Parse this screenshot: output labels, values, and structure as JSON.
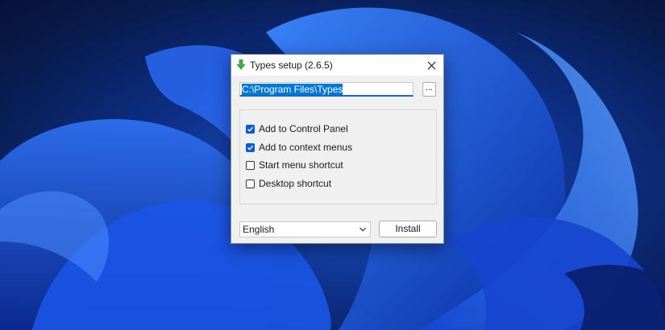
{
  "window": {
    "title": "Types setup (2.6.5)",
    "icon": "green-down-arrow-icon"
  },
  "install_path": {
    "value": "C:\\Program Files\\Types"
  },
  "browse_button": {
    "label": "..."
  },
  "options": [
    {
      "label": "Add to Control Panel",
      "checked": true
    },
    {
      "label": "Add to context menus",
      "checked": true
    },
    {
      "label": "Start menu shortcut",
      "checked": false
    },
    {
      "label": "Desktop shortcut",
      "checked": false
    }
  ],
  "language": {
    "selected": "English"
  },
  "install_button": {
    "label": "Install"
  },
  "colors": {
    "accent": "#0b5ccc",
    "selection": "#0078d7",
    "app_icon": "#3cb043",
    "wallpaper": "#0d2f86"
  }
}
